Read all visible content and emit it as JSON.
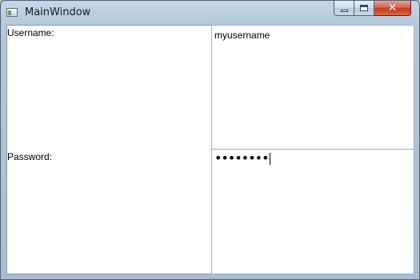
{
  "window": {
    "title": "MainWindow",
    "controls": {
      "minimize": "minimize",
      "maximize": "maximize",
      "close": "close"
    }
  },
  "form": {
    "username_label": "Username:",
    "username_value": "myusername",
    "password_label": "Password:",
    "password_masked": "••••••••"
  },
  "icons": {
    "app": "window-icon",
    "minimize": "minimize-icon",
    "maximize": "maximize-icon",
    "close": "close-icon"
  },
  "colors": {
    "titlebar": "#b4c8dc",
    "close_button": "#c2391f",
    "focus_border": "#7eb4ea"
  }
}
